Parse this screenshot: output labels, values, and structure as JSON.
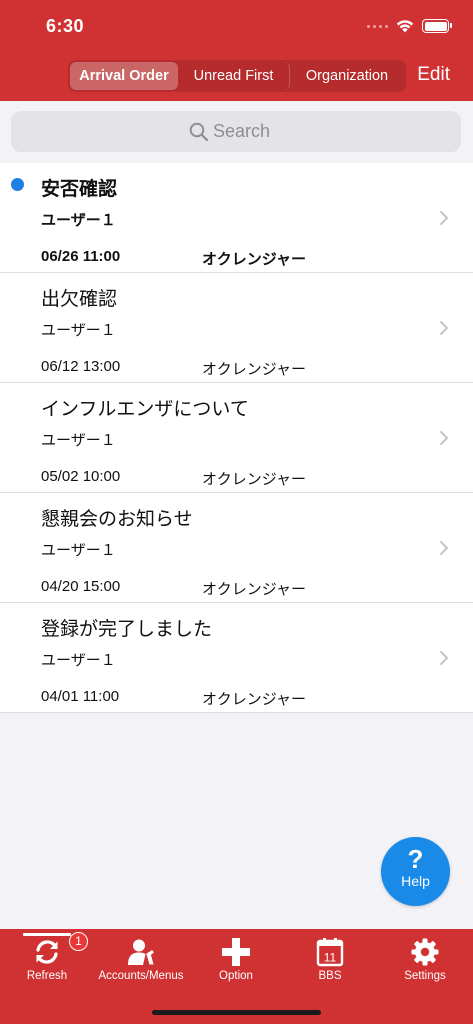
{
  "status_bar": {
    "time": "6:30"
  },
  "header": {
    "segments": [
      {
        "label": "Arrival Order",
        "active": true
      },
      {
        "label": "Unread First",
        "active": false
      },
      {
        "label": "Organization",
        "active": false
      }
    ],
    "edit_label": "Edit"
  },
  "search": {
    "placeholder": "Search"
  },
  "messages": [
    {
      "title": "安否確認",
      "user": "ユーザー１",
      "date": "06/26 11:00",
      "org": "オクレンジャー",
      "unread": true
    },
    {
      "title": "出欠確認",
      "user": "ユーザー１",
      "date": "06/12 13:00",
      "org": "オクレンジャー",
      "unread": false
    },
    {
      "title": "インフルエンザについて",
      "user": "ユーザー１",
      "date": "05/02 10:00",
      "org": "オクレンジャー",
      "unread": false
    },
    {
      "title": "懇親会のお知らせ",
      "user": "ユーザー１",
      "date": "04/20 15:00",
      "org": "オクレンジャー",
      "unread": false
    },
    {
      "title": "登録が完了しました",
      "user": "ユーザー１",
      "date": "04/01 11:00",
      "org": "オクレンジャー",
      "unread": false
    }
  ],
  "help": {
    "symbol": "?",
    "label": "Help"
  },
  "tabbar": {
    "badge": "1",
    "tabs": [
      {
        "label": "Refresh",
        "icon": "refresh-icon"
      },
      {
        "label": "Accounts/Menus",
        "icon": "account-icon"
      },
      {
        "label": "Option",
        "icon": "plus-icon"
      },
      {
        "label": "BBS",
        "icon": "calendar-icon",
        "icon_text": "11"
      },
      {
        "label": "Settings",
        "icon": "gear-icon"
      }
    ]
  },
  "colors": {
    "brand_red": "#d03233",
    "unread_dot": "#1e7fe3",
    "help_blue": "#1a8ae8",
    "badge_red": "#e8383a"
  }
}
